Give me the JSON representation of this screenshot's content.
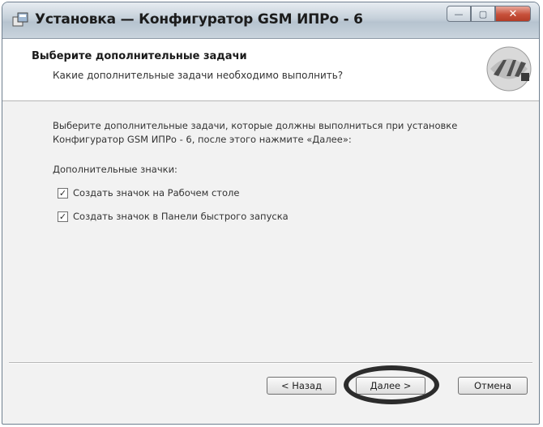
{
  "window": {
    "title": "Установка — Конфигуратор GSM ИПРо - 6",
    "minimize_glyph": "—",
    "maximize_glyph": "▢",
    "close_glyph": "✕"
  },
  "header": {
    "title": "Выберите дополнительные задачи",
    "subtitle": "Какие дополнительные задачи необходимо выполнить?"
  },
  "content": {
    "description": "Выберите дополнительные задачи, которые должны выполниться при установке Конфигуратор GSM ИПРо - 6, после этого нажмите «Далее»:",
    "group_label": "Дополнительные значки:",
    "tasks": [
      {
        "label": "Создать значок на Рабочем столе",
        "checked": true,
        "check_glyph": "✓"
      },
      {
        "label": "Создать значок в Панели быстрого запуска",
        "checked": true,
        "check_glyph": "✓"
      }
    ]
  },
  "buttons": {
    "back": "< Назад",
    "next": "Далее >",
    "cancel": "Отмена"
  },
  "icons": {
    "app": "installer-icon",
    "logo": "company-logo-icon"
  }
}
